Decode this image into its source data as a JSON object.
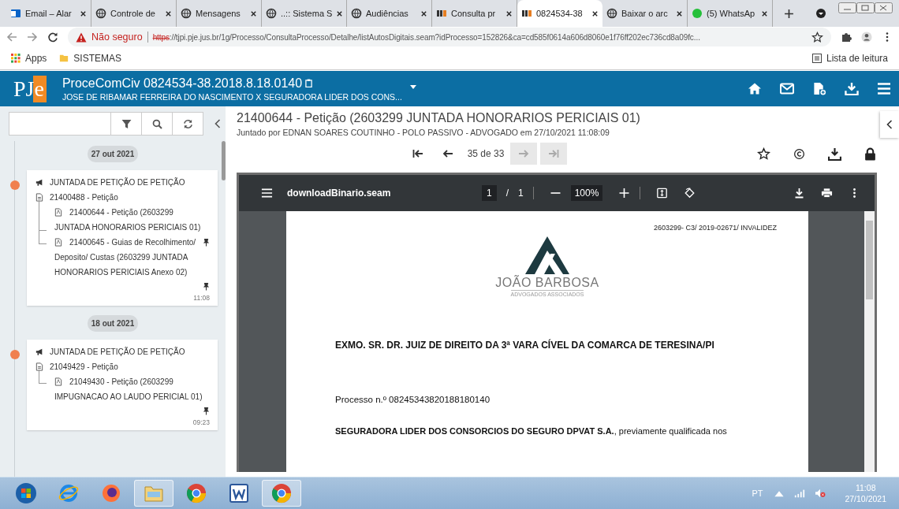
{
  "browser": {
    "tabs": [
      {
        "label": "Email – Alar",
        "kind": "outlook",
        "selected": false
      },
      {
        "label": "Controle de",
        "kind": "globe",
        "selected": false
      },
      {
        "label": "Mensagens",
        "kind": "globe",
        "selected": false
      },
      {
        "label": "..:: Sistema S",
        "kind": "globe",
        "selected": false
      },
      {
        "label": "Audiências",
        "kind": "globe",
        "selected": false
      },
      {
        "label": "Consulta pr",
        "kind": "pje",
        "selected": false
      },
      {
        "label": "0824534-38",
        "kind": "pje",
        "selected": true
      },
      {
        "label": "Baixar o arc",
        "kind": "globe",
        "selected": false
      },
      {
        "label": "(5) WhatsAp",
        "kind": "whatsapp",
        "selected": false
      }
    ],
    "security_label": "Não seguro",
    "url_scheme": "https",
    "url_rest": "://tjpi.pje.jus.br/1g/Processo/ConsultaProcesso/Detalhe/listAutosDigitais.seam?idProcesso=152826&ca=cd585f0614a606d8060e1f76ff202ec736cd8a09fc...",
    "bookmarks": [
      "Apps",
      "SISTEMAS"
    ],
    "reading_list": "Lista de leitura"
  },
  "header": {
    "logo": "PJe",
    "process": "ProceComCiv 0824534-38.2018.8.18.0140",
    "parties": "JOSE DE RIBAMAR FERREIRA DO NASCIMENTO X SEGURADORA LIDER DOS CONS..."
  },
  "timeline": [
    {
      "date": "27 out 2021",
      "events": [
        {
          "title": "JUNTADA DE PETIÇÃO DE PETIÇÃO",
          "document": "21400488 - Petição",
          "attachments": [
            {
              "text": "21400644 - Petição (2603299 JUNTADA HONORARIOS PERICIAIS 01)",
              "pinned": false
            },
            {
              "text": "21400645 - Guias de Recolhimento/ Deposito/ Custas (2603299 JUNTADA HONORARIOS PERICIAIS Anexo 02)",
              "pinned": true
            }
          ],
          "pinned": true,
          "time": "11:08"
        }
      ]
    },
    {
      "date": "18 out 2021",
      "events": [
        {
          "title": "JUNTADA DE PETIÇÃO DE PETIÇÃO",
          "document": "21049429 - Petição",
          "attachments": [
            {
              "text": "21049430 - Petição (2603299 IMPUGNACAO AO LAUDO PERICIAL 01)",
              "pinned": false
            }
          ],
          "pinned": true,
          "time": "09:23"
        }
      ]
    }
  ],
  "document": {
    "title": "21400644 - Petição (2603299 JUNTADA HONORARIOS PERICIAIS 01)",
    "subtitle": "Juntado por EDNAN SOARES COUTINHO - POLO PASSIVO - ADVOGADO em 27/10/2021 11:08:09",
    "page_counter": "35 de 33",
    "next_disabled": true
  },
  "pdf_viewer": {
    "file": "downloadBinario.seam",
    "page": "1",
    "page_sep": "/",
    "pages": "1",
    "zoom": "100%",
    "reference": "2603299- C3/ 2019-02671/ INVALIDEZ",
    "firm_name": "JOÃO BARBOSA",
    "firm_tagline": "ADVOGADOS ASSOCIADOS",
    "addressee": "EXMO. SR. DR. JUIZ DE DIREITO DA 3ª VARA CÍVEL DA COMARCA DE TERESINA/PI",
    "process_line": "Processo n.º 08245343820188180140",
    "party_line": "**SEGURADORA LIDER DOS CONSORCIOS DO SEGURO DPVAT S.A.**, previamente qualificada nos"
  },
  "taskbar": {
    "apps": [
      {
        "kind": "start",
        "active": false
      },
      {
        "kind": "ie",
        "active": false
      },
      {
        "kind": "firefox",
        "active": false
      },
      {
        "kind": "explorer",
        "active": true
      },
      {
        "kind": "chrome",
        "active": false
      },
      {
        "kind": "word",
        "active": false
      },
      {
        "kind": "chrome",
        "active": true
      }
    ],
    "language": "PT",
    "time": "11:08",
    "date": "27/10/2021"
  }
}
